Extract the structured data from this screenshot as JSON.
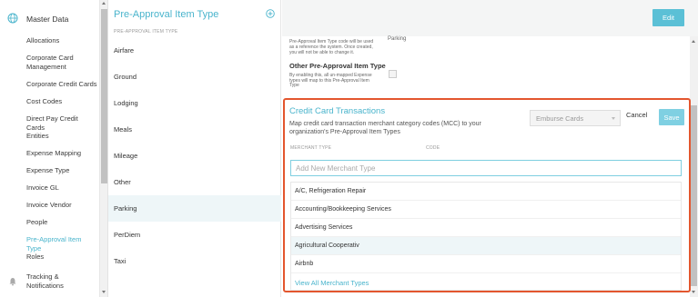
{
  "sidebar": {
    "header": "Master Data",
    "items": [
      {
        "label": "Allocations"
      },
      {
        "label": "Corporate Card Management"
      },
      {
        "label": "Corporate Credit Cards"
      },
      {
        "label": "Cost Codes"
      },
      {
        "label": "Direct Pay Credit Cards"
      },
      {
        "label": "Entities"
      },
      {
        "label": "Expense Mapping"
      },
      {
        "label": "Expense Type"
      },
      {
        "label": "Invoice GL"
      },
      {
        "label": "Invoice Vendor"
      },
      {
        "label": "People"
      },
      {
        "label": "Pre-Approval Item Type"
      },
      {
        "label": "Roles"
      }
    ],
    "bottom": "Tracking & Notifications",
    "active_color": "#49b4cc"
  },
  "middle": {
    "title": "Pre-Approval Item Type",
    "subheader": "PRE-APPROVAL ITEM TYPE",
    "items": [
      "Airfare",
      "Ground",
      "Lodging",
      "Meals",
      "Mileage",
      "Other",
      "Parking",
      "PerDiem",
      "Taxi"
    ],
    "selected": "Parking"
  },
  "topbar": {
    "edit": "Edit"
  },
  "details": {
    "info_text": "Pre-Approval Item Type code will be used as a reference the system. Once created, you will not be able to change it.",
    "info_right": "Parking",
    "other_title": "Other Pre-Approval Item Type",
    "other_desc": "By enabling this, all un-mapped Expense types will map to this Pre-Approval Item Type"
  },
  "credit_card": {
    "title": "Credit Card Transactions",
    "description": "Map credit card transaction merchant category codes (MCC) to your organization's Pre-Approval Item Types",
    "select_value": "Emburse Cards",
    "cancel": "Cancel",
    "save": "Save",
    "col_merchant": "MERCHANT TYPE",
    "col_code": "CODE",
    "input_placeholder": "Add New Merchant Type",
    "merchants": [
      "A/C, Refrigeration Repair",
      "Accounting/Bookkeeping Services",
      "Advertising Services",
      "Agricultural Cooperativ",
      "Airbnb"
    ],
    "highlighted": "Agricultural Cooperativ",
    "view_all": "View All Merchant Types",
    "border_color": "#e3562e"
  }
}
